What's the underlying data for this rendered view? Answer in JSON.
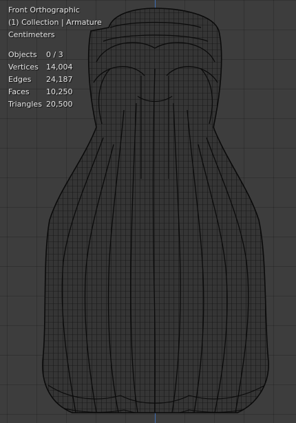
{
  "viewport": {
    "view_name": "Front Orthographic",
    "collection_label": "(1) Collection | Armature",
    "units": "Centimeters"
  },
  "stats": [
    {
      "label": "Objects",
      "value": "0 / 3"
    },
    {
      "label": "Vertices",
      "value": "14,004"
    },
    {
      "label": "Edges",
      "value": "24,187"
    },
    {
      "label": "Faces",
      "value": "10,250"
    },
    {
      "label": "Triangles",
      "value": "20,500"
    }
  ],
  "colors": {
    "background": "#3d3d3d",
    "wire": "#0e0e0e",
    "axis": "#3f6fb4",
    "overlay_text": "#e6e6e6"
  },
  "icons": [
    "wireframe-mesh"
  ]
}
